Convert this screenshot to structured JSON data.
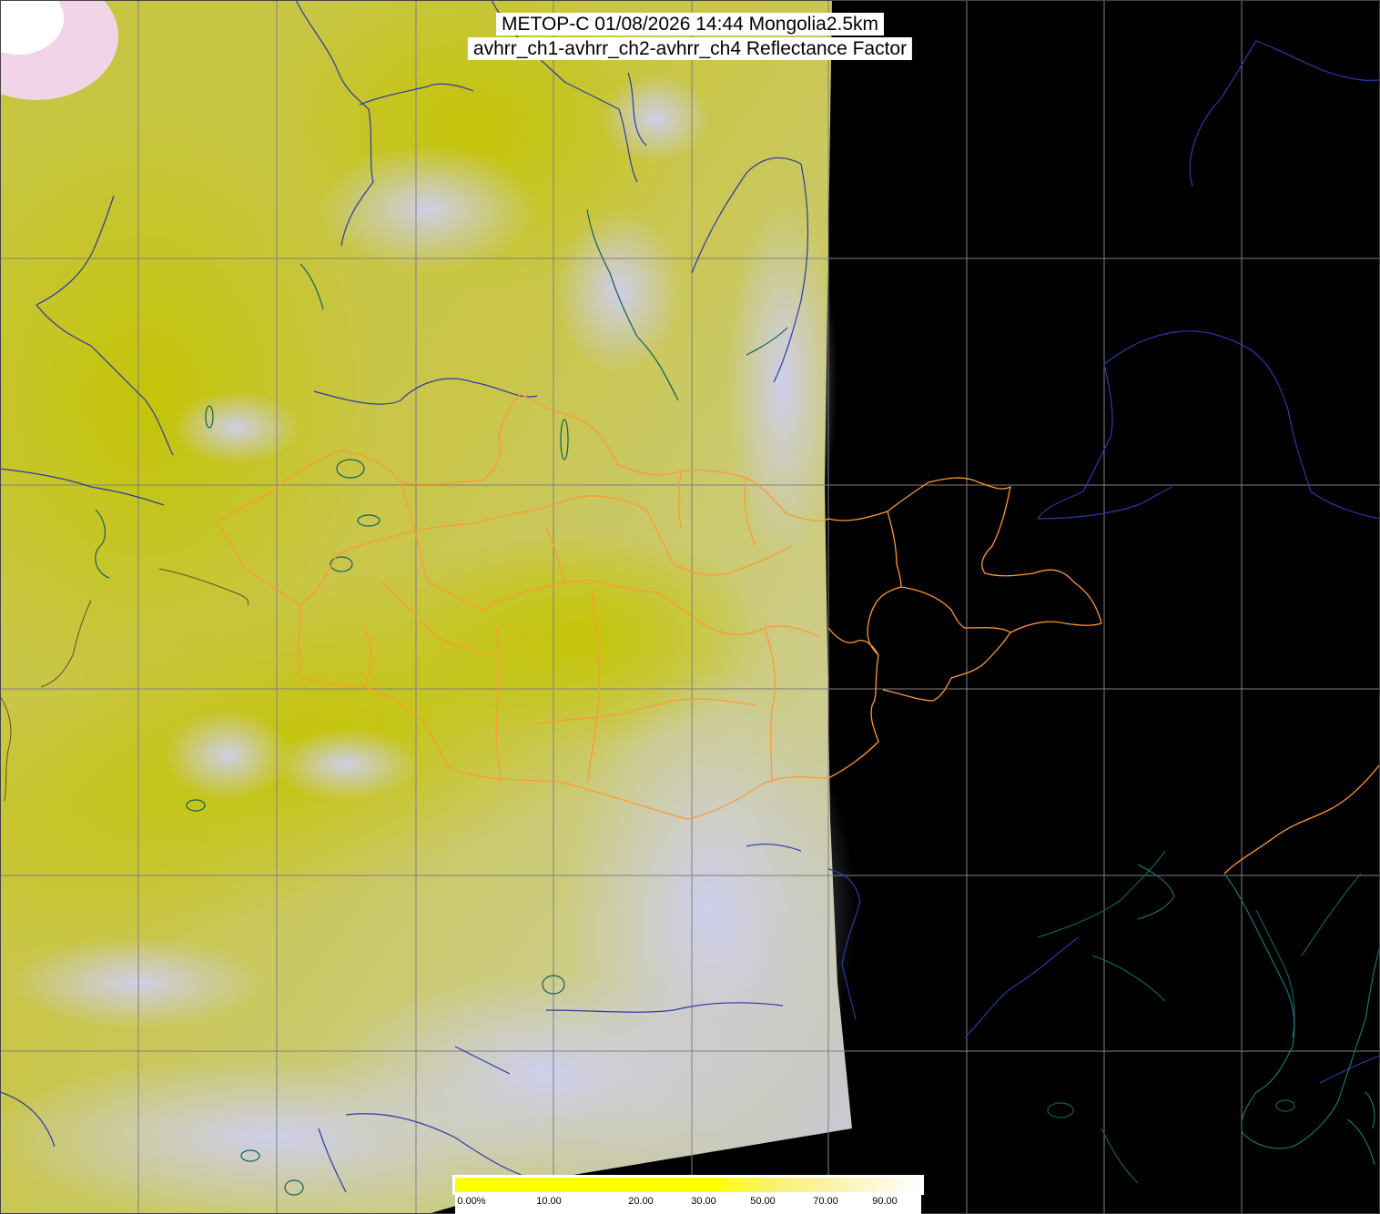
{
  "title": {
    "line1": "METOP-C 01/08/2026 14:44 Mongolia2.5km",
    "line2": "avhrr_ch1-avhrr_ch2-avhrr_ch4 Reflectance Factor"
  },
  "colorbar": {
    "tick_labels": [
      "0.00%",
      "10.00",
      "20.00",
      "30.00",
      "50.00",
      "70.00",
      "90.00"
    ],
    "tick_values": [
      0,
      10,
      20,
      30,
      50,
      70,
      90
    ],
    "colors": {
      "low": "#ffff00",
      "mid": "#f8f26e",
      "high": "#ffffff"
    }
  },
  "colors": {
    "no_data": "#000000",
    "clear_land": "#c8c83a",
    "cloud": "#c8c8f0",
    "country_border": "#ff9933",
    "coastline_river": "#2a3aa8",
    "lake": "#10605a",
    "graticule": "#808080"
  }
}
